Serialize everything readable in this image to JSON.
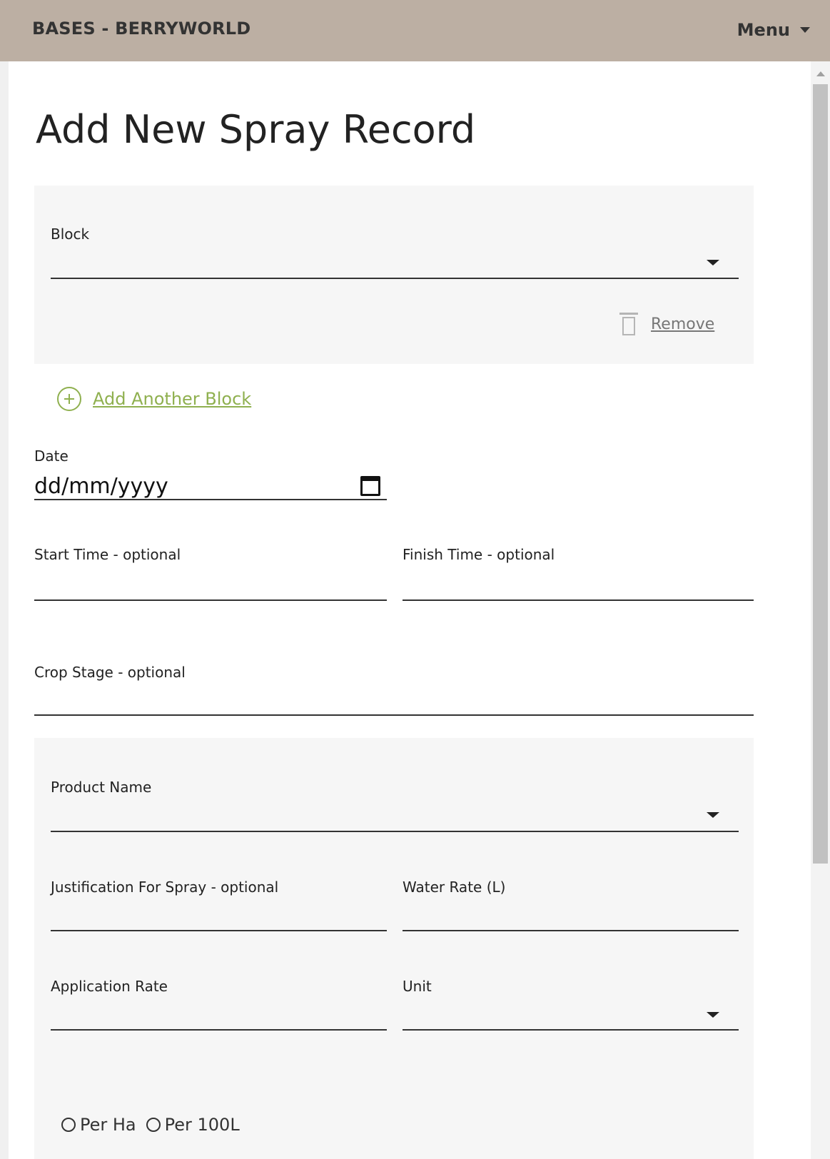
{
  "header": {
    "app_title": "BASES - BERRYWORLD",
    "menu_label": "Menu"
  },
  "page": {
    "title": "Add New Spray Record"
  },
  "block_panel": {
    "block_label": "Block",
    "block_value": "",
    "remove_label": "Remove"
  },
  "add_block_label": "Add Another Block",
  "date": {
    "label": "Date",
    "value": "dd/mm/yyyy"
  },
  "times": {
    "start_label": "Start Time - optional",
    "finish_label": "Finish Time - optional"
  },
  "crop_stage": {
    "label": "Crop Stage - optional"
  },
  "product_panel": {
    "product_name_label": "Product Name",
    "justification_label": "Justification For Spray - optional",
    "water_rate_label": "Water Rate (L)",
    "application_rate_label": "Application Rate",
    "unit_label": "Unit",
    "radio_options": [
      "Per Ha",
      "Per 100L"
    ]
  },
  "icons": {
    "menu": "chevron-down-icon",
    "select": "chevron-down-icon",
    "remove": "trash-icon",
    "add": "plus-circle-icon",
    "date": "calendar-icon"
  },
  "colors": {
    "header_bg": "#bcafa3",
    "panel_bg": "#f6f6f6",
    "accent_green": "#8fb04f"
  }
}
